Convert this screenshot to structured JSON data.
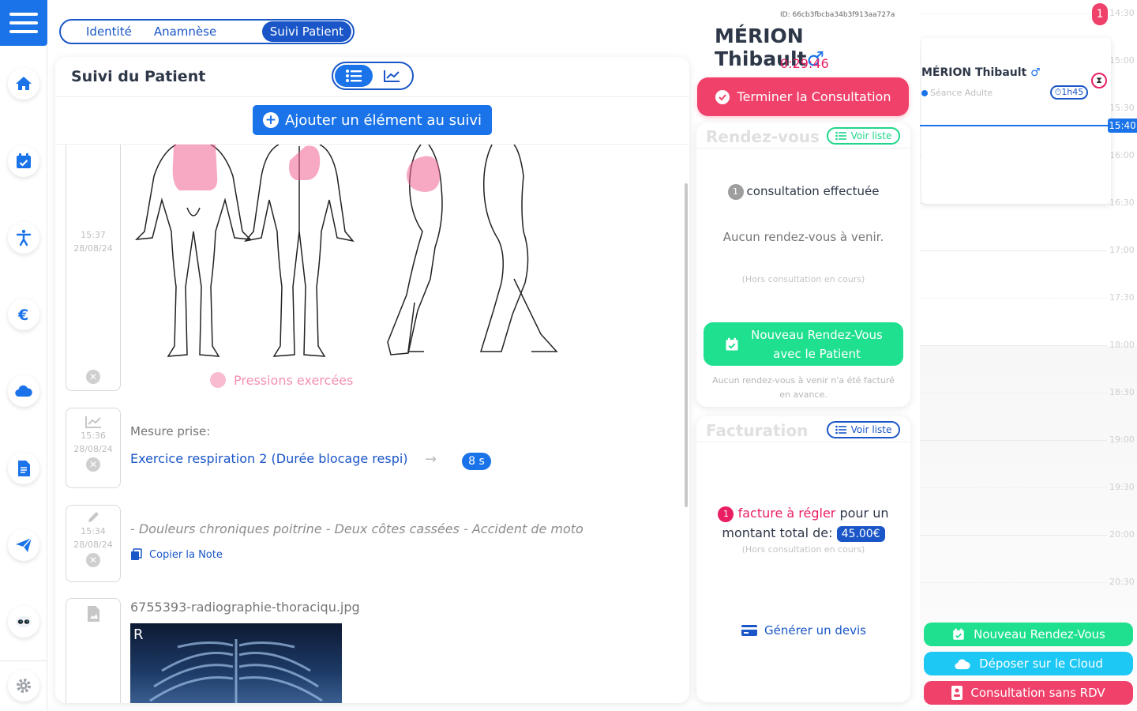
{
  "sidebar": {
    "items": [
      {
        "name": "home-icon"
      },
      {
        "name": "calendar-check-icon"
      },
      {
        "name": "accessibility-icon"
      },
      {
        "name": "euro-icon"
      },
      {
        "name": "cloud-icon"
      },
      {
        "name": "document-icon"
      },
      {
        "name": "send-icon"
      },
      {
        "name": "robot-icon"
      },
      {
        "name": "gear-icon"
      }
    ]
  },
  "tabs": [
    "Identité",
    "Anamnèse",
    "Suivi Patient"
  ],
  "suivi": {
    "title": "Suivi du Patient",
    "add_button": "Ajouter un élément au suivi",
    "entries": [
      {
        "time": "15:37",
        "date": "28/08/24",
        "legend": "Pressions exercées"
      },
      {
        "time": "15:36",
        "date": "28/08/24",
        "label": "Mesure prise:",
        "measure": "Exercice respiration 2 (Durée blocage respi)",
        "value": "8 s"
      },
      {
        "time": "15:34",
        "date": "28/08/24",
        "note": "- Douleurs chroniques poitrine - Deux côtes cassées - Accident de moto",
        "copy": "Copier la Note"
      },
      {
        "file": "6755393-radiographie-thoraciqu.jpg",
        "xray_letter": "R"
      }
    ]
  },
  "patient": {
    "id": "ID: 66cb3fbcba34b3f913aa727a",
    "name": "MÉRION Thibault",
    "gender_symbol": "♂",
    "timer": "0:29:46",
    "end_button": "Terminer la Consultation"
  },
  "rdv": {
    "title": "Rendez-vous",
    "voir": "Voir liste",
    "count": "1",
    "consult_text": "consultation effectuée",
    "aucun": "Aucun rendez-vous à venir.",
    "hors": "(Hors consultation en cours)",
    "new_button_l1": "Nouveau Rendez-Vous",
    "new_button_l2": "avec le Patient",
    "aucun_facture": "Aucun rendez-vous à venir n'a été facturé en avance."
  },
  "facturation": {
    "title": "Facturation",
    "voir": "Voir liste",
    "count": "1",
    "facture_text": "facture à régler",
    "pour_un": "pour un",
    "montant": "montant total de:",
    "amount": "45.00€",
    "hors": "(Hors consultation en cours)",
    "devis": "Générer un devis"
  },
  "calendar": {
    "badge": "1",
    "hours": [
      "14:30",
      "15:00",
      "15:30",
      "16:00",
      "16:30",
      "17:00",
      "17:30",
      "18:00",
      "18:30",
      "19:00",
      "19:30",
      "20:00",
      "20:30"
    ],
    "now": "15:40",
    "appointment": {
      "name": "MÉRION Thibault",
      "gender_symbol": "♂",
      "type": "Séance Adulte",
      "duration": "1h45"
    },
    "buttons": {
      "new_rdv": "Nouveau Rendez-Vous",
      "cloud": "Déposer sur le Cloud",
      "sans_rdv": "Consultation sans RDV"
    }
  },
  "colors": {
    "primary": "#1a73e8",
    "navy": "#1a56c7",
    "pink": "#f0416a",
    "green": "#1fe08f",
    "cyan": "#1ec8f5"
  }
}
